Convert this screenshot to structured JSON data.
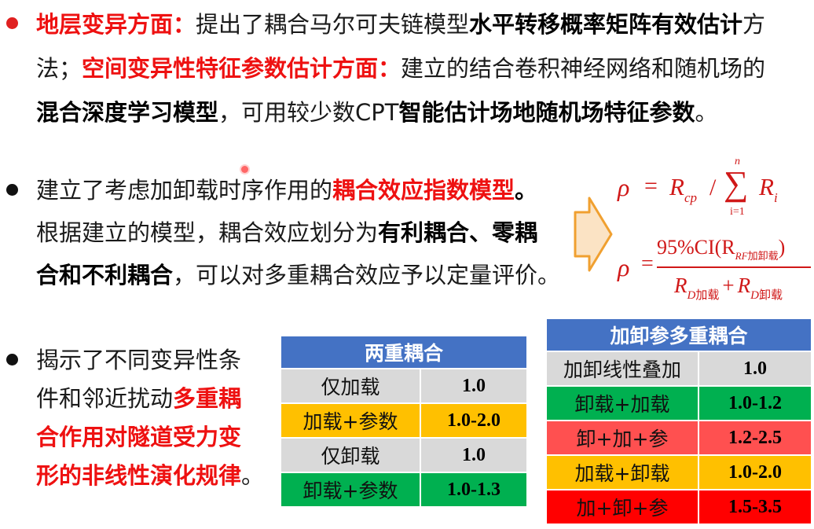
{
  "section1": {
    "l1_red": "地层变异方面：",
    "l1_text": "提出了耦合马尔可夫链模型",
    "l1_bold": "水平转移概率矩阵有效估计",
    "l1_tail": "方",
    "l2_start": "法；",
    "l2_red": "空间变异性特征参数估计方面：",
    "l2_text": "建立的结合卷积神经网络和随机场的",
    "l3_bold": "混合深度学习模型",
    "l3_text": "，可用较少数CPT",
    "l3_bold2": "智能估计场地随机场特征参数",
    "l3_end": "。"
  },
  "section2": {
    "l1_text": "建立了考虑加卸载时序作用的",
    "l1_red": "耦合效应指数模型",
    "l1_end": "。",
    "l2_text": "根据建立的模型，耦合效应划分为",
    "l2_bold": "有利耦合、零耦",
    "l3_bold": "合和不利耦合",
    "l3_text": "，可以对多重耦合效应予以定量评价。"
  },
  "formula1": {
    "rho": "ρ",
    "eq": "=",
    "r_base": "R",
    "r_sub": "cp",
    "slash": "/",
    "sum_top": "n",
    "sum_sym": "∑",
    "sum_bot": "i=1",
    "ri_base": "R",
    "ri_sub": "i"
  },
  "formula2": {
    "rho": "ρ",
    "eq": "=",
    "num_main": "95%CI(R",
    "num_sub": "RF",
    "num_sub_cjk": "加卸载",
    "num_close": ")",
    "den_r1": "R",
    "den_sub1": "D",
    "den_sub1_cjk": "加载",
    "den_plus": "+",
    "den_r2": "R",
    "den_sub2": "D",
    "den_sub2_cjk": "卸载"
  },
  "section3": {
    "l1": "揭示了不同变异性条",
    "l2_text": "件和邻近扰动",
    "l2_red": "多重耦",
    "l3_red": "合作用对隧道受力变",
    "l4_red": "形的非线性演化规律",
    "l4_end": "。"
  },
  "table_double": {
    "header": "两重耦合",
    "rows": [
      {
        "label": "仅加载",
        "value": "1.0"
      },
      {
        "label": "加载+参数",
        "value": "1.0-2.0"
      },
      {
        "label": "仅卸载",
        "value": "1.0"
      },
      {
        "label": "卸载+参数",
        "value": "1.0-1.3"
      }
    ]
  },
  "table_multi": {
    "header": "加卸参多重耦合",
    "rows": [
      {
        "label": "加卸线性叠加",
        "value": "1.0"
      },
      {
        "label": "卸载+加载",
        "value": "1.0-1.2"
      },
      {
        "label": "卸+加+参",
        "value": "1.2-2.5"
      },
      {
        "label": "加载+卸载",
        "value": "1.0-2.0"
      },
      {
        "label": "加+卸+参",
        "value": "1.5-3.5"
      }
    ]
  },
  "colors": {
    "red_text": "#ee1111",
    "formula_red": "#d01818",
    "header_blue": "#4472c4",
    "grey": "#d9d9d9",
    "gold": "#ffc000",
    "green": "#00b050",
    "salmon": "#ff5050",
    "red": "#ff0000",
    "arrow_fill": "#fbe3c4",
    "arrow_stroke": "#f0a030"
  }
}
